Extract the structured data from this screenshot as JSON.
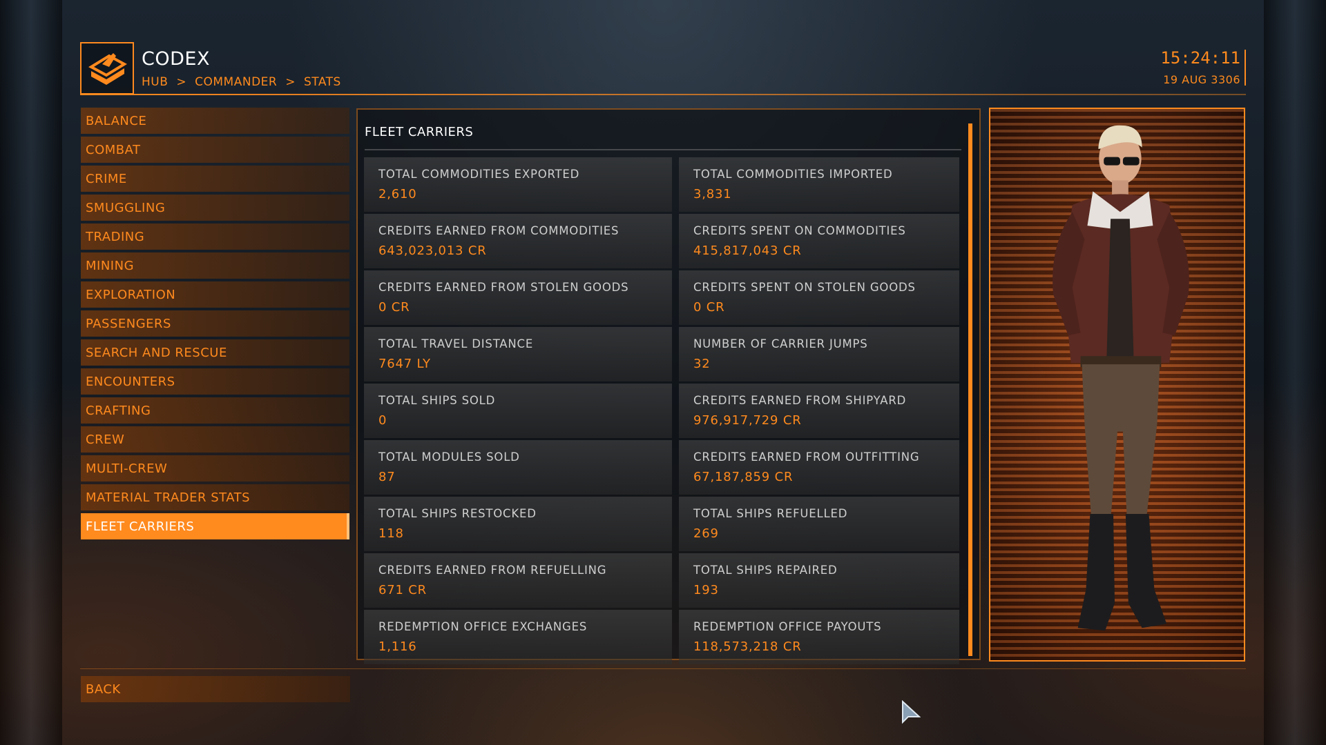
{
  "header": {
    "title": "CODEX",
    "breadcrumb": [
      "HUB",
      ">",
      "COMMANDER",
      ">",
      "STATS"
    ],
    "time": "15:24:11",
    "date": "19 AUG 3306"
  },
  "sidebar": {
    "items": [
      {
        "label": "BALANCE"
      },
      {
        "label": "COMBAT"
      },
      {
        "label": "CRIME"
      },
      {
        "label": "SMUGGLING"
      },
      {
        "label": "TRADING"
      },
      {
        "label": "MINING"
      },
      {
        "label": "EXPLORATION"
      },
      {
        "label": "PASSENGERS"
      },
      {
        "label": "SEARCH AND RESCUE"
      },
      {
        "label": "ENCOUNTERS"
      },
      {
        "label": "CRAFTING"
      },
      {
        "label": "CREW"
      },
      {
        "label": "MULTI-CREW"
      },
      {
        "label": "MATERIAL TRADER STATS"
      },
      {
        "label": "FLEET CARRIERS"
      }
    ],
    "active_index": 14
  },
  "panel": {
    "title": "FLEET CARRIERS",
    "stats": [
      {
        "label": "TOTAL COMMODITIES EXPORTED",
        "value": "2,610"
      },
      {
        "label": "TOTAL COMMODITIES IMPORTED",
        "value": "3,831"
      },
      {
        "label": "CREDITS EARNED FROM COMMODITIES",
        "value": "643,023,013 CR"
      },
      {
        "label": "CREDITS SPENT ON COMMODITIES",
        "value": "415,817,043 CR"
      },
      {
        "label": "CREDITS EARNED FROM STOLEN GOODS",
        "value": "0 CR"
      },
      {
        "label": "CREDITS SPENT ON STOLEN GOODS",
        "value": "0 CR"
      },
      {
        "label": "TOTAL TRAVEL DISTANCE",
        "value": "7647 LY"
      },
      {
        "label": "NUMBER OF CARRIER JUMPS",
        "value": "32"
      },
      {
        "label": "TOTAL SHIPS SOLD",
        "value": "0"
      },
      {
        "label": "CREDITS EARNED FROM SHIPYARD",
        "value": "976,917,729 CR"
      },
      {
        "label": "TOTAL MODULES SOLD",
        "value": "87"
      },
      {
        "label": "CREDITS EARNED FROM OUTFITTING",
        "value": "67,187,859 CR"
      },
      {
        "label": "TOTAL SHIPS RESTOCKED",
        "value": "118"
      },
      {
        "label": "TOTAL SHIPS REFUELLED",
        "value": "269"
      },
      {
        "label": "CREDITS EARNED FROM REFUELLING",
        "value": "671 CR"
      },
      {
        "label": "TOTAL SHIPS REPAIRED",
        "value": "193"
      },
      {
        "label": "REDEMPTION OFFICE EXCHANGES",
        "value": "1,116"
      },
      {
        "label": "REDEMPTION OFFICE PAYOUTS",
        "value": "118,573,218 CR"
      }
    ]
  },
  "footer": {
    "back_label": "BACK"
  },
  "icons": {
    "logo": "codex-book-icon",
    "cursor": "mouse-pointer-icon"
  },
  "colors": {
    "accent": "#ff8a1e",
    "label": "#cfcfcf",
    "title": "#ffffff"
  }
}
